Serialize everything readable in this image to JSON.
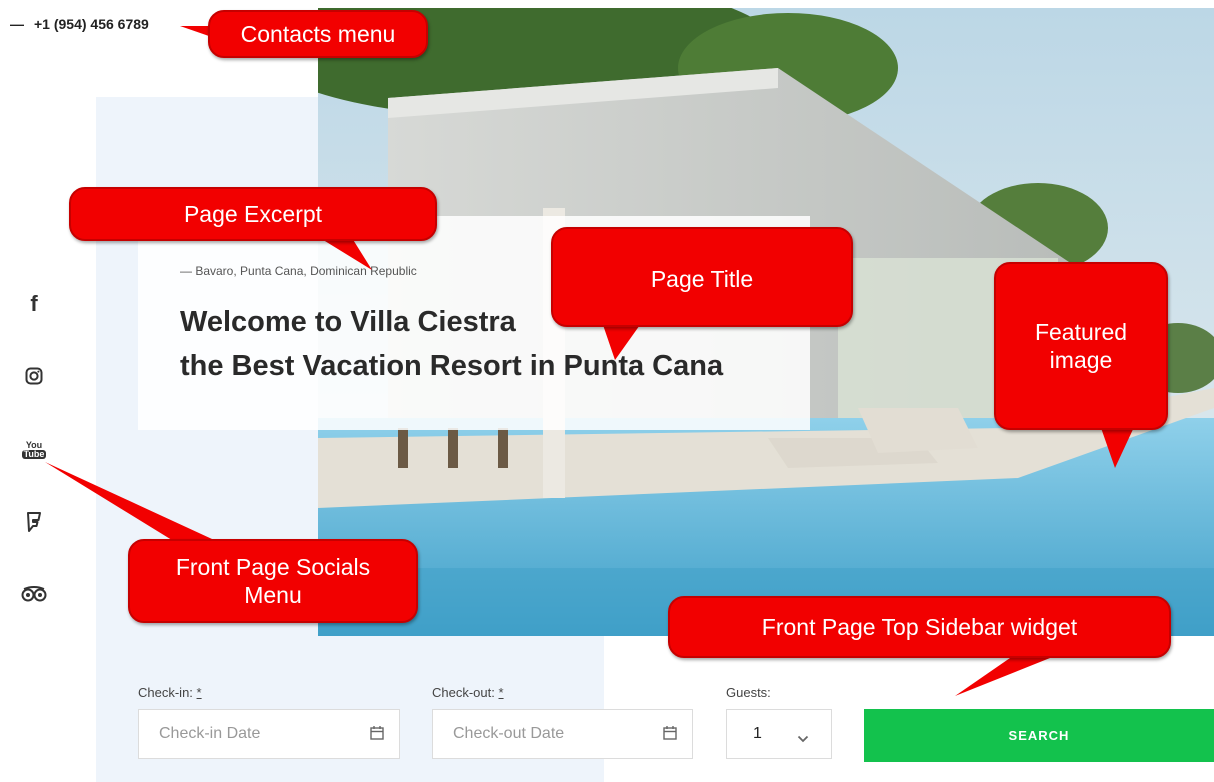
{
  "contacts": {
    "dash": "—",
    "phone": "+1 (954) 456 6789"
  },
  "hero": {
    "excerpt": "— Bavaro, Punta Cana, Dominican Republic",
    "title_line1": "Welcome to Villa Ciestra",
    "title_line2": "the Best Vacation Resort in Punta Cana"
  },
  "socials": [
    {
      "icon": "facebook-icon",
      "glyph": "f"
    },
    {
      "icon": "instagram-icon"
    },
    {
      "icon": "youtube-icon",
      "text_top": "You",
      "text_bottom": "Tube"
    },
    {
      "icon": "foursquare-icon"
    },
    {
      "icon": "tripadvisor-icon"
    }
  ],
  "booking": {
    "checkin_label": "Check-in:",
    "checkin_required": "*",
    "checkin_placeholder": "Check-in Date",
    "checkout_label": "Check-out:",
    "checkout_required": "*",
    "checkout_placeholder": "Check-out Date",
    "guests_label": "Guests:",
    "guests_value": "1",
    "search_label": "SEARCH"
  },
  "callouts": {
    "contacts": "Contacts menu",
    "excerpt": "Page Excerpt",
    "title": "Page Title",
    "featured": "Featured image",
    "socials": "Front Page Socials Menu",
    "sidebar": "Front Page Top Sidebar widget"
  },
  "colors": {
    "callout": "#f20000",
    "search_button": "#13c24d",
    "tint_panel": "#eef4fb"
  }
}
